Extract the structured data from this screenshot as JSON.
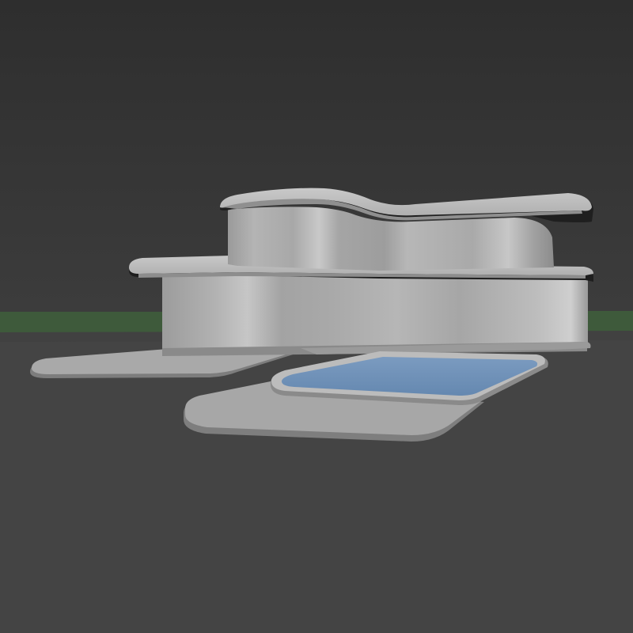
{
  "scene": {
    "description_icon": "3d-render-viewport",
    "colors": {
      "sky_top": "#2f2f2f",
      "sky_bottom": "#3b3b3b",
      "ground": "#454545",
      "grass": "#3f5a3c",
      "wall_light": "#c4c4c4",
      "wall_mid": "#a9a9a9",
      "wall_dark": "#8e8e8e",
      "slab_top": "#bdbdbd",
      "slab_edge": "#8a8a8a",
      "slab_underside": "#1f1f1f",
      "patio": "#a6a6a6",
      "patio_edge": "#7d7d7d",
      "pool_water": "#6e8fb5",
      "pool_rim": "#b9b9b9"
    }
  }
}
